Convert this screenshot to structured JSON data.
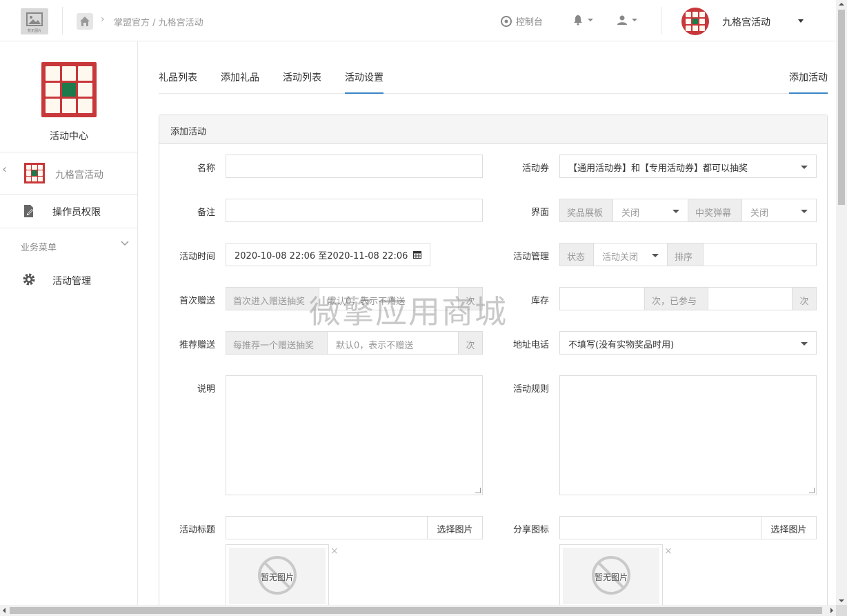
{
  "header": {
    "logo_caption": "暂无图片",
    "breadcrumb": "掌盟官方 / 九格宫活动",
    "console_label": "控制台",
    "user_name": "九格宫活动"
  },
  "sidebar": {
    "title": "活动中心",
    "current_app": "九格宫活动",
    "permissions": "操作员权限",
    "section": "业务菜单",
    "activity_manage": "活动管理"
  },
  "tabs": {
    "gift_list": "礼品列表",
    "add_gift": "添加礼品",
    "activity_list": "活动列表",
    "activity_settings": "活动设置",
    "add_activity": "添加活动"
  },
  "form": {
    "panel_title": "添加活动",
    "name_label": "名称",
    "remark_label": "备注",
    "time_label": "活动时间",
    "time_value": "2020-10-08 22:06 至2020-11-08 22:06",
    "first_gift_label": "首次赠送",
    "first_gift_addon": "首次进入赠送抽奖",
    "first_gift_placeholder": "默认0，表示不赠送",
    "times_unit": "次",
    "recommend_label": "推荐赠送",
    "recommend_addon": "每推荐一个赠送抽奖",
    "recommend_placeholder": "默认0，表示不赠送",
    "desc_label": "说明",
    "title_img_label": "活动标题",
    "choose_image": "选择图片",
    "no_image": "暂无图片",
    "coupon_label": "活动券",
    "coupon_value": "【通用活动券】和【专用活动券】都可以抽奖",
    "ui_label": "界面",
    "prize_board": "奖品展板",
    "off": "关闭",
    "win_popup": "中奖弹幕",
    "manage_label": "活动管理",
    "status": "状态",
    "activity_closed": "活动关闭",
    "sort": "排序",
    "stock_label": "库存",
    "stock_addon": "次，已参与",
    "address_label": "地址电话",
    "address_value": "不填写(没有实物奖品时用)",
    "rules_label": "活动规则",
    "share_icon_label": "分享图标"
  },
  "watermark": "微擎应用商城"
}
